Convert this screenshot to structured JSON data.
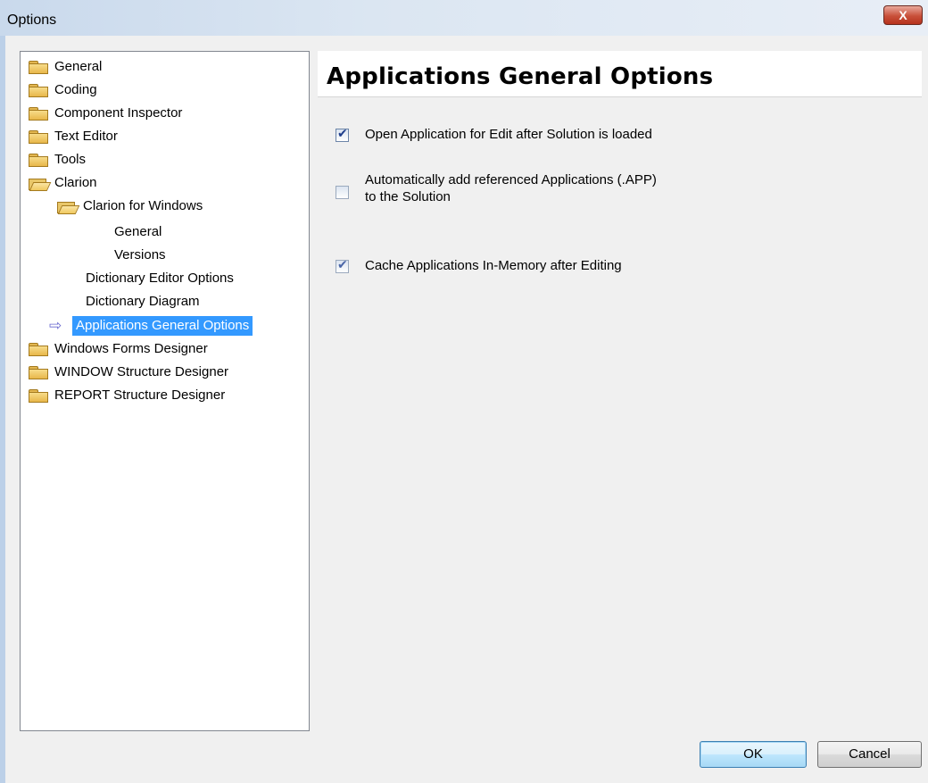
{
  "window": {
    "title": "Options",
    "close_glyph": "X"
  },
  "tree": {
    "items": [
      {
        "label": "General",
        "icon": "folder-closed-icon"
      },
      {
        "label": "Coding",
        "icon": "folder-closed-icon"
      },
      {
        "label": "Component Inspector",
        "icon": "folder-closed-icon"
      },
      {
        "label": "Text Editor",
        "icon": "folder-closed-icon"
      },
      {
        "label": "Tools",
        "icon": "folder-closed-icon"
      },
      {
        "label": "Clarion",
        "icon": "folder-open-icon"
      },
      {
        "label": "Clarion for Windows",
        "icon": "folder-open-icon"
      },
      {
        "label": "General"
      },
      {
        "label": "Versions"
      },
      {
        "label": "Dictionary Editor Options"
      },
      {
        "label": "Dictionary Diagram"
      },
      {
        "label": "Applications General Options",
        "icon": "arrow-right-icon",
        "selected": true
      },
      {
        "label": "Windows Forms Designer",
        "icon": "folder-closed-icon"
      },
      {
        "label": "WINDOW Structure Designer",
        "icon": "folder-closed-icon"
      },
      {
        "label": "REPORT Structure Designer",
        "icon": "folder-closed-icon"
      }
    ],
    "selection_color": "#3399ff"
  },
  "panel": {
    "title": "Applications General Options",
    "options": [
      {
        "label": "Open Application for Edit after Solution is loaded",
        "checked": true
      },
      {
        "label_line1": "Automatically add referenced Applications (.APP)",
        "label_line2": "to the Solution",
        "checked": false
      },
      {
        "label": "Cache Applications In-Memory after Editing",
        "checked": true
      }
    ]
  },
  "buttons": {
    "ok": "OK",
    "cancel": "Cancel"
  },
  "colors": {
    "titlebar": "#dbe6f2",
    "close_button": "#c8503a"
  }
}
